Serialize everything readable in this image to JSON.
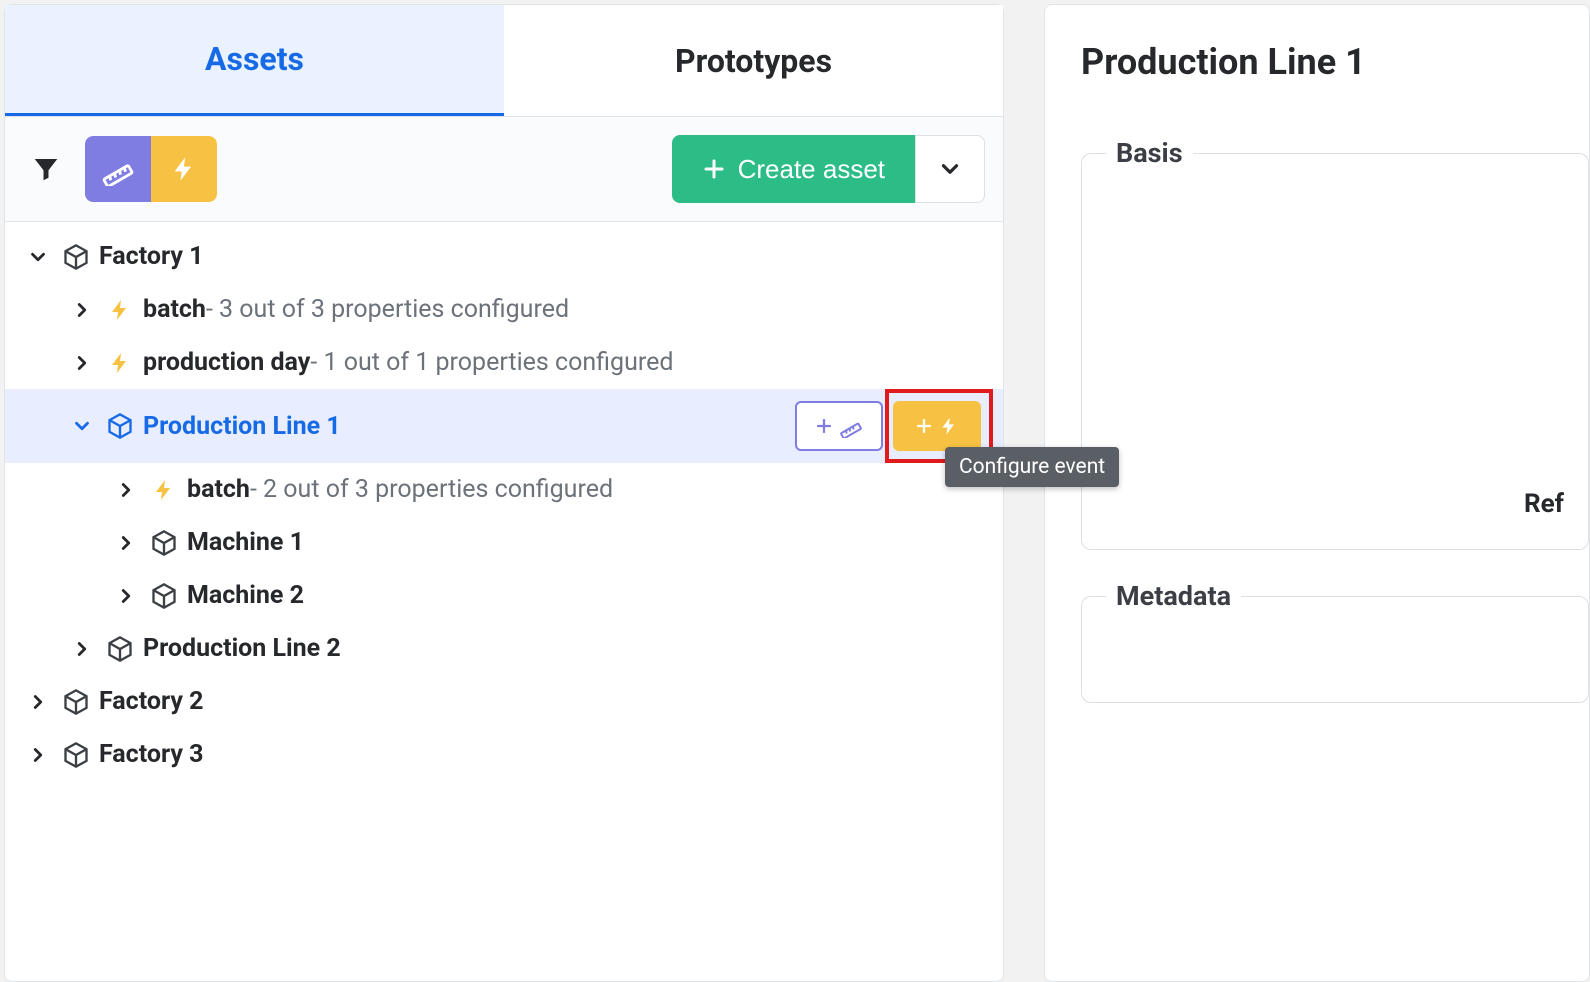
{
  "tabs": {
    "assets": "Assets",
    "prototypes": "Prototypes"
  },
  "toolbar": {
    "create_label": "Create asset"
  },
  "tree": {
    "factory1": "Factory 1",
    "batch1_name": "batch",
    "batch1_detail": " - 3 out of 3 properties configured",
    "prodday_name": "production day",
    "prodday_detail": " - 1 out of 1 properties configured",
    "line1": "Production Line 1",
    "batch2_name": "batch",
    "batch2_detail": " - 2 out of 3 properties configured",
    "machine1": "Machine 1",
    "machine2": "Machine 2",
    "line2": "Production Line 2",
    "factory2": "Factory 2",
    "factory3": "Factory 3"
  },
  "tooltip": {
    "configure_event": "Configure event"
  },
  "detail": {
    "title": "Production Line 1",
    "section_basis": "Basis",
    "section_metadata": "Metadata",
    "refresh": "Ref"
  }
}
